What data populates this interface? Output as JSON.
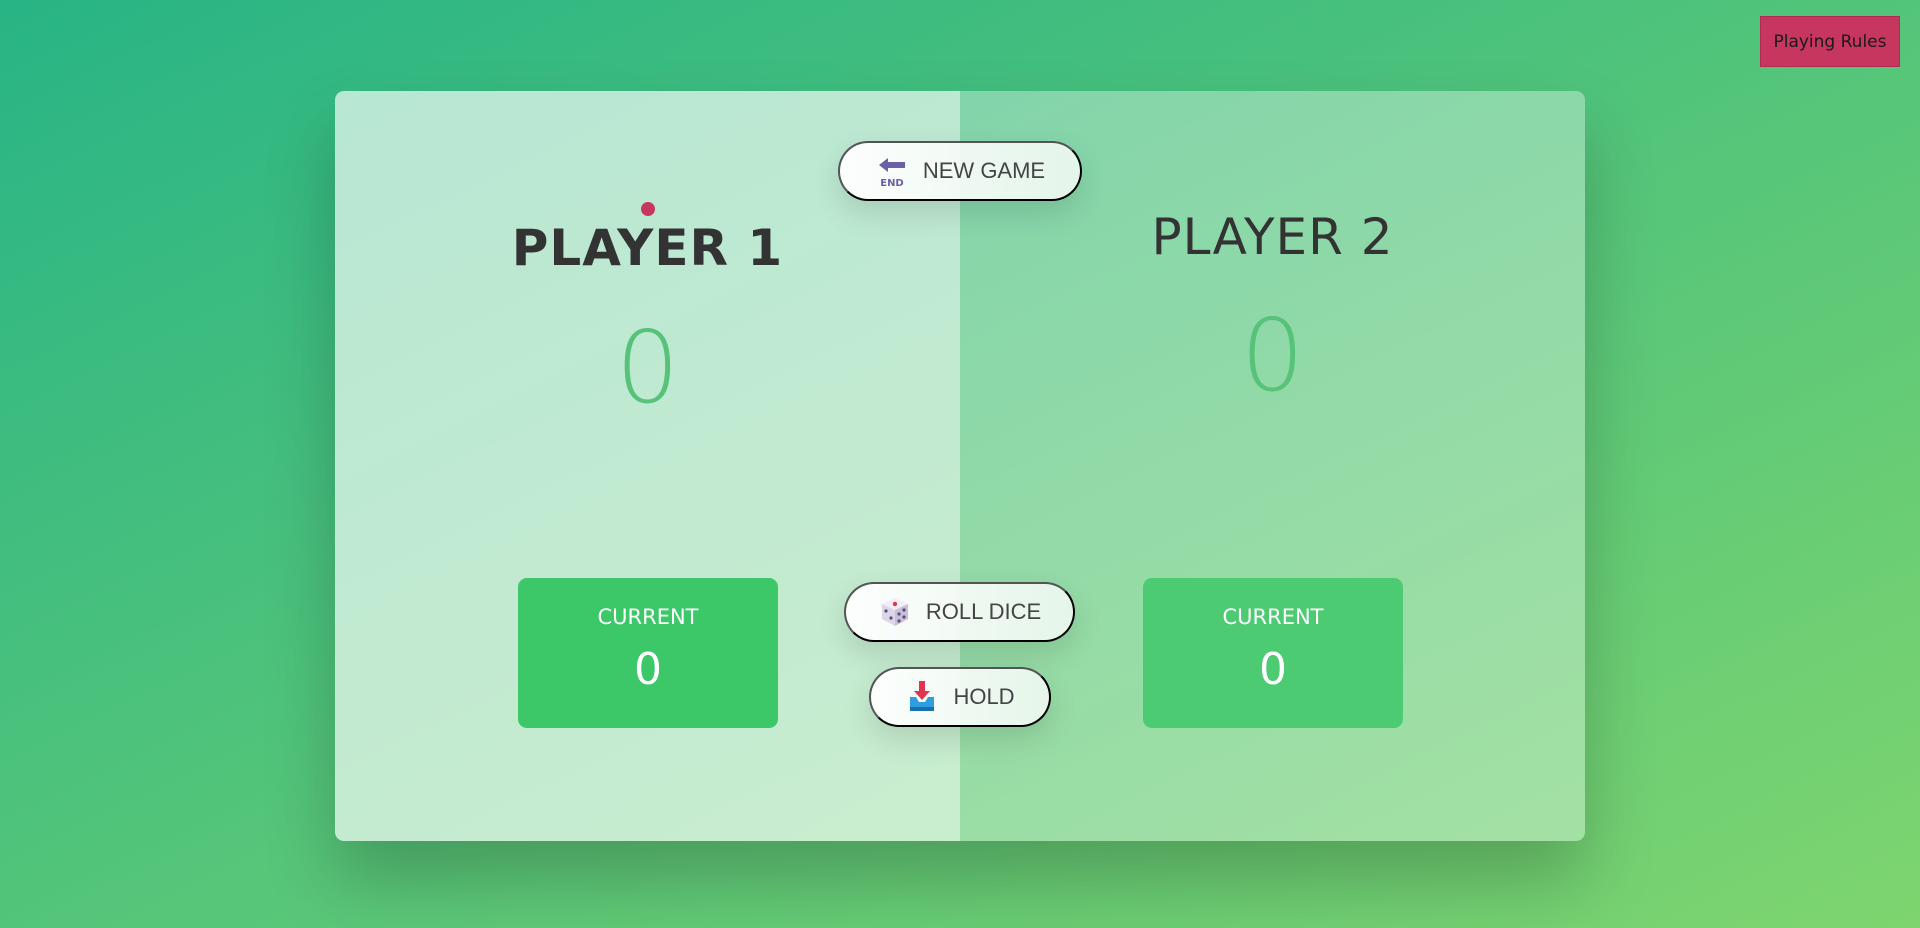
{
  "rules_button": {
    "label": "Playing Rules"
  },
  "players": [
    {
      "name": "PLAYER 1",
      "score": "0",
      "current_label": "CURRENT",
      "current_score": "0"
    },
    {
      "name": "PLAYER 2",
      "score": "0",
      "current_label": "CURRENT",
      "current_score": "0"
    }
  ],
  "buttons": {
    "new_game": {
      "label": "NEW GAME",
      "icon": "end-arrow-icon"
    },
    "roll_dice": {
      "label": "ROLL DICE",
      "icon": "dice-icon"
    },
    "hold": {
      "label": "HOLD",
      "icon": "inbox-tray-icon"
    }
  },
  "colors": {
    "accent": "#c7365f",
    "score_green": "#57c27a",
    "current_box_green": "#3cc869"
  }
}
